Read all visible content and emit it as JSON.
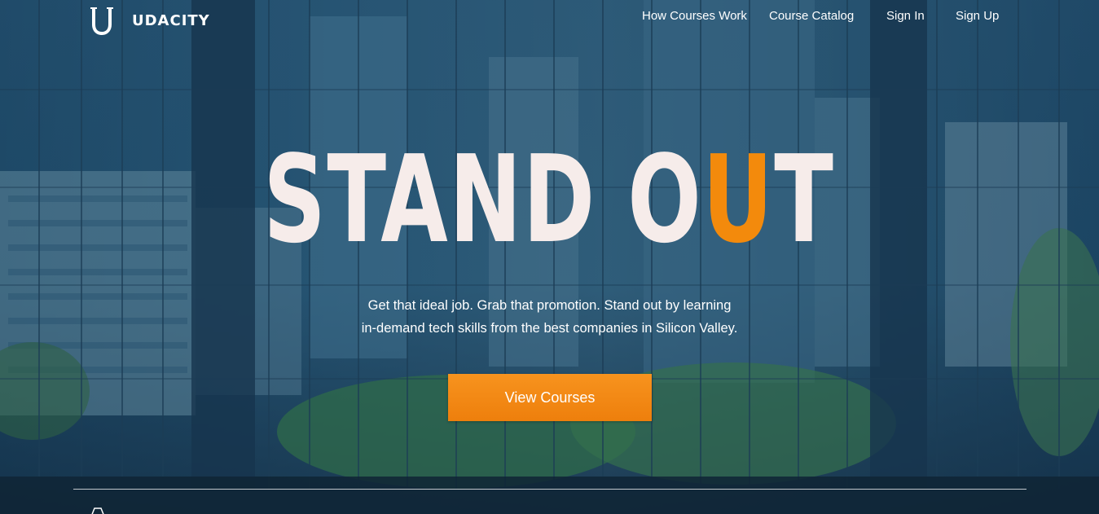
{
  "brand": {
    "name": "UDACITY",
    "logo_letter": "U"
  },
  "nav": {
    "items": [
      {
        "label": "How Courses Work"
      },
      {
        "label": "Course Catalog"
      },
      {
        "label": "Sign In"
      },
      {
        "label": "Sign Up"
      }
    ]
  },
  "hero": {
    "headline_main": "STAND O",
    "headline_accent": "U",
    "headline_end": "T",
    "subtitle_line1": "Get that ideal job. Grab that promotion. Stand out by learning",
    "subtitle_line2": "in-demand tech skills from the best companies in Silicon Valley.",
    "cta_label": "View Courses"
  },
  "colors": {
    "accent": "#f38a0c",
    "overlay": "#24506e",
    "text": "#ffffff"
  }
}
